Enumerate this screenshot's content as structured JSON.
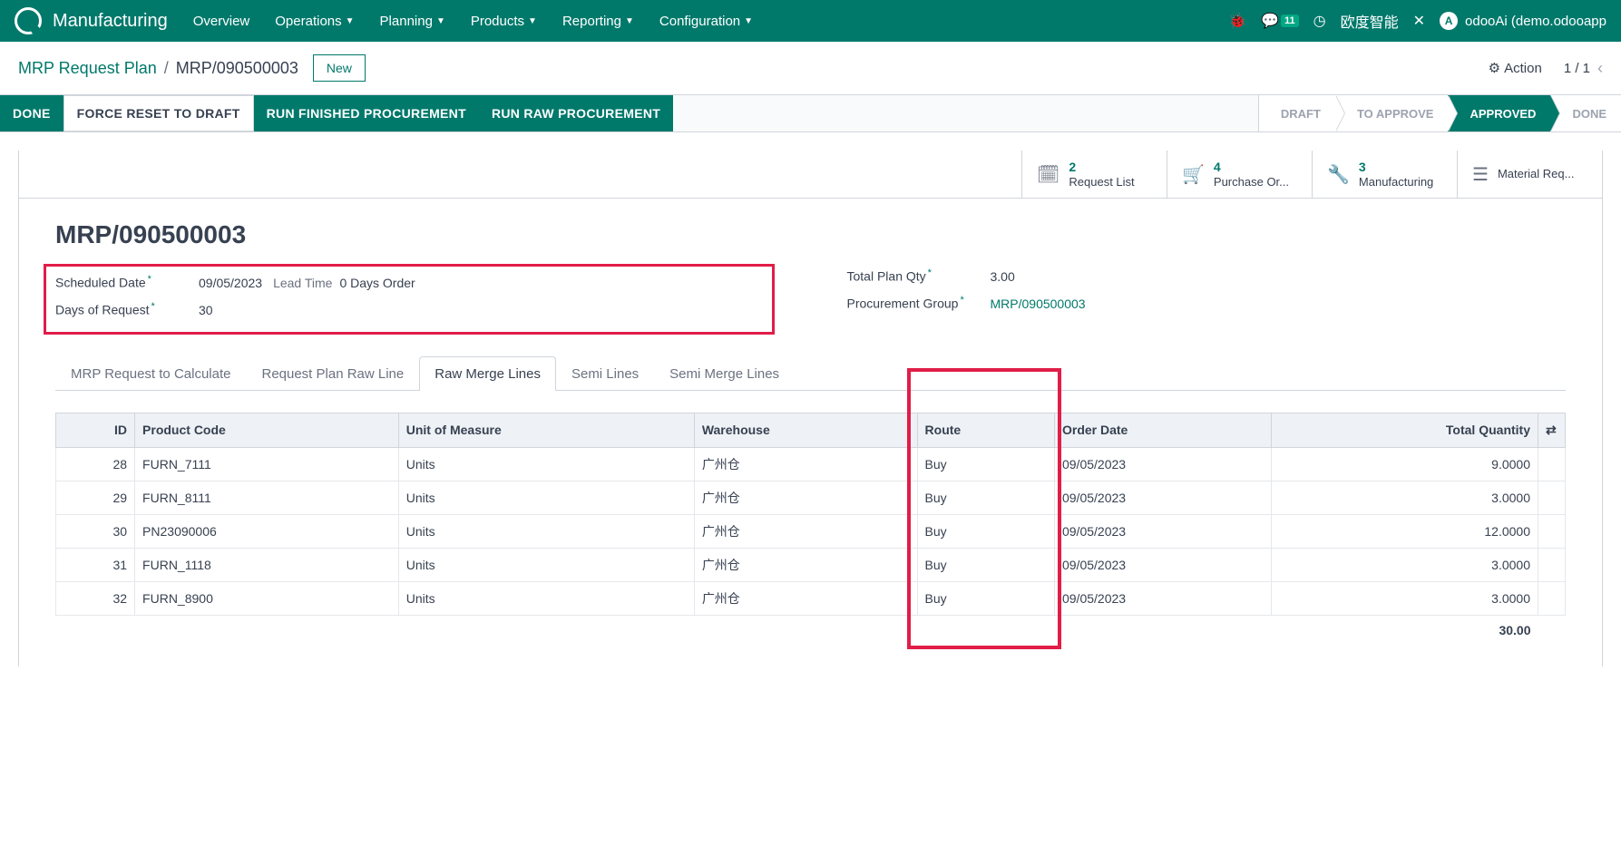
{
  "nav": {
    "app": "Manufacturing",
    "items": [
      "Overview",
      "Operations",
      "Planning",
      "Products",
      "Reporting",
      "Configuration"
    ],
    "item_has_caret": [
      false,
      true,
      true,
      true,
      true,
      true
    ],
    "msg_badge": "11",
    "company": "欧度智能",
    "user": "odooAi (demo.odooapp"
  },
  "crumb": {
    "root": "MRP Request Plan",
    "current": "MRP/090500003",
    "new_btn": "New",
    "action": "Action",
    "pager": "1 / 1"
  },
  "statusbar": {
    "buttons": [
      "DONE",
      "FORCE RESET TO DRAFT",
      "RUN FINISHED PROCUREMENT",
      "RUN RAW PROCUREMENT"
    ],
    "button_primary": [
      true,
      false,
      true,
      true
    ],
    "stages": [
      "DRAFT",
      "TO APPROVE",
      "APPROVED",
      "DONE"
    ],
    "active_idx": 2
  },
  "stats": [
    {
      "num": "2",
      "label": "Request List"
    },
    {
      "num": "4",
      "label": "Purchase Or..."
    },
    {
      "num": "3",
      "label": "Manufacturing"
    },
    {
      "num": "",
      "label": "Material Req..."
    }
  ],
  "record": {
    "title": "MRP/090500003",
    "scheduled_label": "Scheduled Date",
    "scheduled": "09/05/2023",
    "lead_label": "Lead Time",
    "lead": "0 Days Order",
    "days_req_label": "Days of Request",
    "days_req": "30",
    "total_qty_label": "Total Plan Qty",
    "total_qty": "3.00",
    "proc_group_label": "Procurement Group",
    "proc_group": "MRP/090500003"
  },
  "tabs": [
    "MRP Request to Calculate",
    "Request Plan Raw Line",
    "Raw Merge Lines",
    "Semi Lines",
    "Semi Merge Lines"
  ],
  "active_tab": 2,
  "table": {
    "headers": [
      "ID",
      "Product Code",
      "Unit of Measure",
      "Warehouse",
      "Route",
      "Order Date",
      "Total Quantity"
    ],
    "rows": [
      [
        "28",
        "FURN_7111",
        "Units",
        "广州仓",
        "Buy",
        "09/05/2023",
        "9.0000"
      ],
      [
        "29",
        "FURN_8111",
        "Units",
        "广州仓",
        "Buy",
        "09/05/2023",
        "3.0000"
      ],
      [
        "30",
        "PN23090006",
        "Units",
        "广州仓",
        "Buy",
        "09/05/2023",
        "12.0000"
      ],
      [
        "31",
        "FURN_1118",
        "Units",
        "广州仓",
        "Buy",
        "09/05/2023",
        "3.0000"
      ],
      [
        "32",
        "FURN_8900",
        "Units",
        "广州仓",
        "Buy",
        "09/05/2023",
        "3.0000"
      ]
    ],
    "footer_total": "30.00"
  }
}
